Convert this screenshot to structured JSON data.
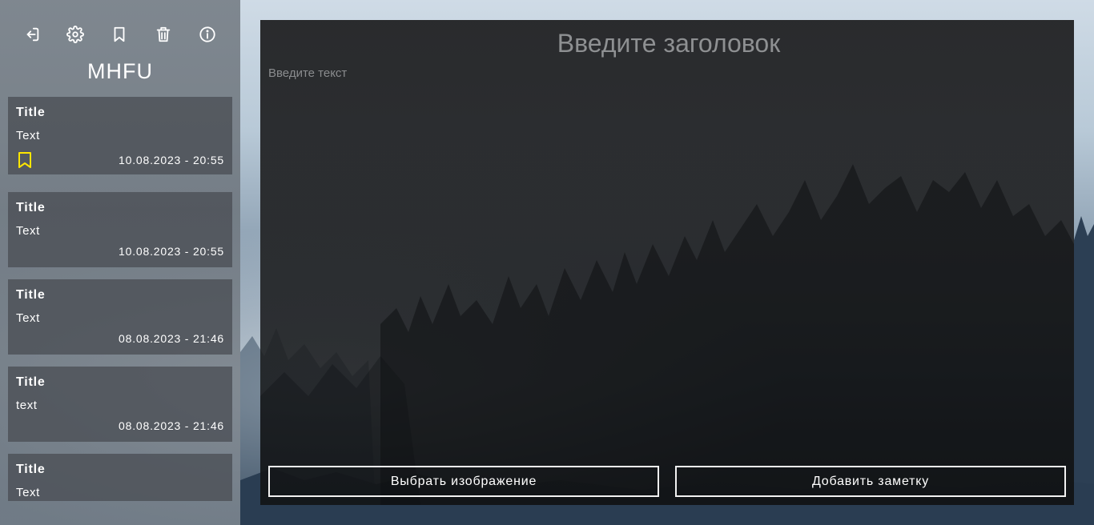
{
  "toolbar": {
    "icons": [
      "logout-icon",
      "gear-icon",
      "bookmark-icon",
      "trash-icon",
      "info-icon"
    ]
  },
  "app": {
    "title": "MHFU"
  },
  "notes": [
    {
      "title": "Title",
      "text": "Text",
      "date": "10.08.2023 - 20:55",
      "bookmarked": true
    },
    {
      "title": "Title",
      "text": "Text",
      "date": "10.08.2023 - 20:55",
      "bookmarked": false
    },
    {
      "title": "Title",
      "text": "Text",
      "date": "08.08.2023 - 21:46",
      "bookmarked": false
    },
    {
      "title": "Title",
      "text": "text",
      "date": "08.08.2023 - 21:46",
      "bookmarked": false
    },
    {
      "title": "Title",
      "text": "Text",
      "date": "",
      "bookmarked": false
    }
  ],
  "editor": {
    "title_placeholder": "Введите заголовок",
    "text_placeholder": "Введите текст",
    "choose_image_label": "Выбрать изображение",
    "add_note_label": "Добавить заметку"
  },
  "colors": {
    "bookmark_active": "#ffe600",
    "icon": "#ffffff"
  }
}
